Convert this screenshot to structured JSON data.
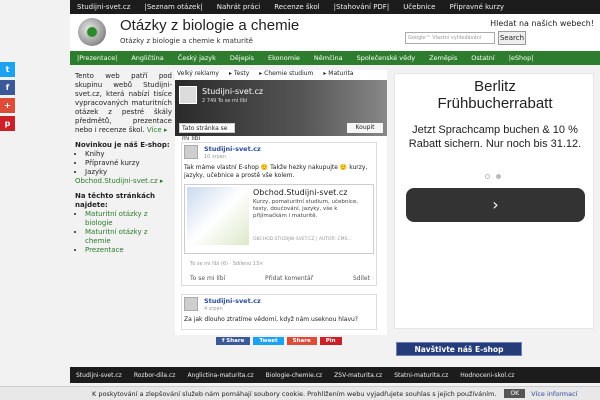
{
  "topbar": {
    "items": [
      "Studijni-svet.cz",
      "|Seznam otázek|",
      "Nahrát práci",
      "Recenze škol",
      "|Stahování PDF|",
      "Učebnice",
      "Připravné kurzy"
    ]
  },
  "header": {
    "title": "Otázky z biologie a chemie",
    "subtitle": "Otázky z biologie a chemie k maturitě",
    "search_label": "Hledat na našich webech!",
    "search_placeholder": "Google™ Vlastní vyhledávání",
    "search_button": "Search"
  },
  "greenbar": {
    "items": [
      "|Prezentace|",
      "Angličtina",
      "Český jazyk",
      "Dějepis",
      "Ekonomie",
      "Němčina",
      "Společenské vědy",
      "Zeměpis",
      "Ostatní",
      "|eShop|"
    ]
  },
  "social": {
    "items": [
      "t",
      "f",
      "+",
      "p"
    ],
    "colors": [
      "#1da1f2",
      "#3b5998",
      "#dd4b39",
      "#cb2027"
    ]
  },
  "left": {
    "intro": "Tento web patří pod skupinu webů Studijni-svet.cz, která nabízí tisíce vypracovaných maturitních otázek z pestré škály předmětů, prezentace nebo i recenze škol.",
    "more": "Více ▸",
    "eshop_heading": "Novinkou je náš E-shop:",
    "eshop_items": [
      "Knihy",
      "Přípravné kurzy",
      "Jazyky"
    ],
    "eshop_link": "Obchod.Studijni-svet.cz ▸",
    "sites_heading": "Na těchto stránkách najdete:",
    "sites_items": [
      "Maturitní otázky z biologie",
      "Maturitní otázky z chemie",
      "Prezentace"
    ]
  },
  "main": {
    "links": [
      "Velký reklamy",
      "▸ Testy",
      "▸ Chemie studium",
      "▸ Maturita"
    ],
    "fb_page": {
      "name": "Studijni-svet.cz",
      "likes": "2 749 To se mi líbí",
      "like_button": "Tato stránka se mi líbí",
      "buy_button": "Koupit"
    },
    "post1": {
      "author": "Studijni-svet.cz",
      "date": "10 srpen",
      "text": "Tak máme vlastní E-shop 🙂 Takže hezky nakupujte 🙂 kurzy, jazyky, učebnice a prostě vše kolem.",
      "card_title": "Obchod.Studijni-svet.cz",
      "card_desc": "Kurzy, pomaturitní studium, učebnice, testy, doučování, jazyky, vše k přijímačkám i maturitě.",
      "card_url": "OBCHOD.STUDIJNI-SVET.CZ | AUTOR: CMS...",
      "meta": "To se mi líbí (6) · Sdíleno 13×",
      "actions": [
        "To se mi líbí",
        "Přidat komentář",
        "Sdílet"
      ]
    },
    "post2": {
      "author": "Studijni-svet.cz",
      "date": "4 srpen",
      "text": "Za jak dlouho ztratíme vědomí, když nám useknou hlavu?"
    },
    "share_buttons": [
      {
        "label": "f Share",
        "color": "#3b5998"
      },
      {
        "label": "Tweet",
        "color": "#1da1f2"
      },
      {
        "label": "Share",
        "color": "#dd4b39"
      },
      {
        "label": "Pin",
        "color": "#cb2027"
      }
    ]
  },
  "ad": {
    "brand": "Berlitz",
    "promo": "Frühbucherrabatt",
    "text": "Jetzt Sprachcamp buchen & 10 % Rabatt sichern. Nur noch bis 31.12.",
    "next": "›"
  },
  "eshop_banner": "Navštivte náš E-shop",
  "footer": {
    "items": [
      "Studijni-svet.cz",
      "Rozbor-dila.cz",
      "Anglictina-maturita.cz",
      "Biologie-chemie.cz",
      "ZSV-maturita.cz",
      "Statni-maturita.cz",
      "Hodnoceni-skol.cz"
    ]
  },
  "cookie": {
    "text": "K poskytování a zlepšování služeb nám pomáhají soubory cookie. Prohlížením webu vyjadřujete souhlas s jejich používáním.",
    "ok": "OK",
    "more": "Více informací"
  }
}
